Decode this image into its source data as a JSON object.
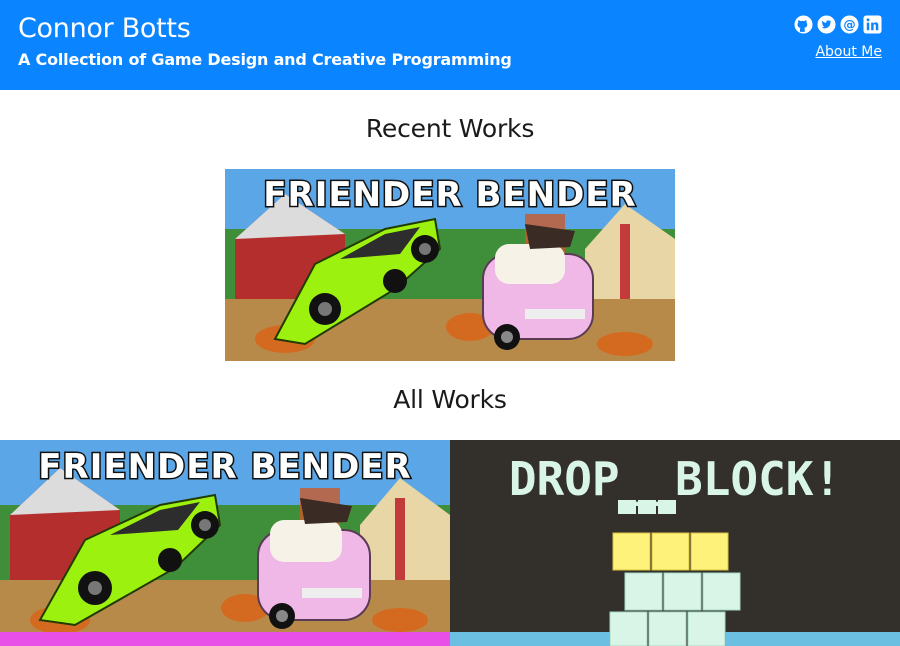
{
  "header": {
    "title": "Connor Botts",
    "subtitle": "A Collection of Game Design and Creative Programming",
    "about_link": "About Me",
    "social_icons": [
      "github-icon",
      "twitter-icon",
      "email-icon",
      "linkedin-icon"
    ],
    "background_color": "#0a84ff"
  },
  "recent": {
    "heading": "Recent Works",
    "items": [
      {
        "title_art": "FRIENDER BENDER"
      }
    ]
  },
  "all": {
    "heading": "All Works",
    "items": [
      {
        "title_art": "FRIENDER BENDER",
        "accent_color": "#e84ee8"
      },
      {
        "title_art": "DROP BLOCK!",
        "accent_color": "#ffe66e"
      }
    ]
  }
}
